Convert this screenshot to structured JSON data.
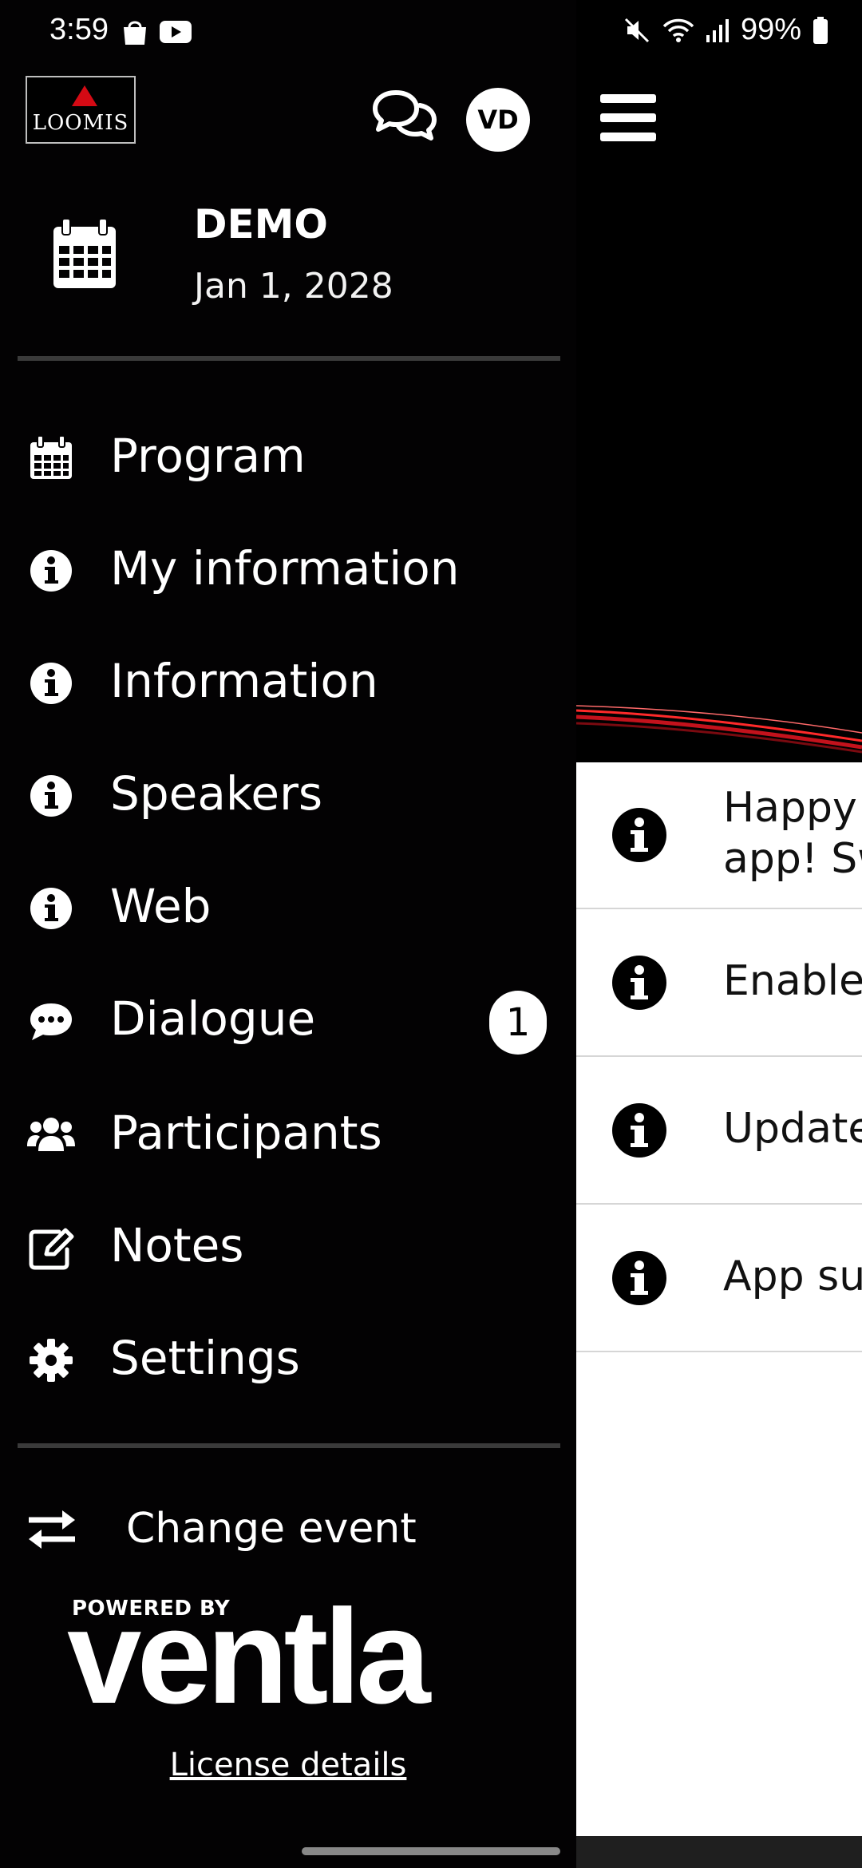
{
  "status_bar": {
    "time": "3:59",
    "battery": "99%",
    "left_icons": [
      "shopping-bag-icon",
      "youtube-icon"
    ],
    "right_icons": [
      "mute-icon",
      "wifi-icon",
      "signal-icon",
      "battery-icon"
    ]
  },
  "header": {
    "logo_text": "LOOMIS",
    "avatar_initials": "VD"
  },
  "event": {
    "name": "DEMO",
    "date": "Jan 1, 2028"
  },
  "menu": {
    "items": [
      {
        "label": "Program",
        "icon": "calendar-icon"
      },
      {
        "label": "My information",
        "icon": "info-icon"
      },
      {
        "label": "Information",
        "icon": "info-icon"
      },
      {
        "label": "Speakers",
        "icon": "info-icon"
      },
      {
        "label": "Web",
        "icon": "info-icon"
      },
      {
        "label": "Dialogue",
        "icon": "chat-bubble-icon",
        "badge": "1"
      },
      {
        "label": "Participants",
        "icon": "users-icon"
      },
      {
        "label": "Notes",
        "icon": "edit-icon"
      },
      {
        "label": "Settings",
        "icon": "gear-icon"
      }
    ]
  },
  "footer": {
    "change_event": "Change event",
    "powered_by": "POWERED BY",
    "brand": "ventla",
    "license": "License details"
  },
  "background": {
    "items": [
      {
        "line1": "Happy",
        "line2": "app! Sw"
      },
      {
        "line1": "Enable"
      },
      {
        "line1": "Update"
      },
      {
        "line1": "App sup"
      }
    ]
  },
  "colors": {
    "drawer_bg": "#030203",
    "accent_red": "#d40a14",
    "divider": "#3a3a3a"
  }
}
